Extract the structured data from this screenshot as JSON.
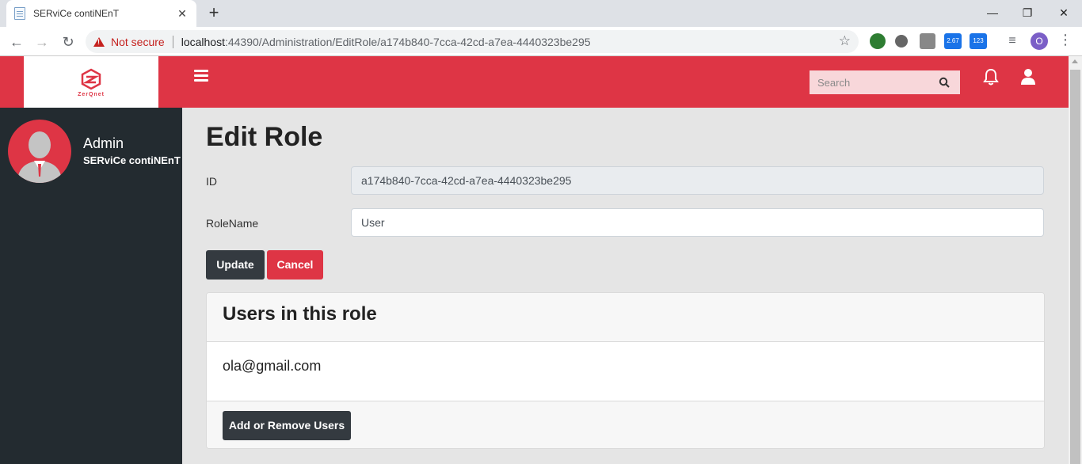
{
  "browser": {
    "tab_title": "SERviCe contiNEnT",
    "tab_close": "✕",
    "new_tab": "+",
    "win_minimize": "—",
    "win_restore": "❐",
    "win_close": "✕",
    "back": "←",
    "forward": "→",
    "reload": "↻",
    "security_text": "Not secure",
    "url_host": "localhost",
    "url_rest": ":44390/Administration/EditRole/a174b840-7cca-42cd-a7ea-4440323be295",
    "star": "☆",
    "ext_badge_1": "2.67",
    "ext_badge_2": "123",
    "profile_initial": "O",
    "menu": "⋮"
  },
  "app": {
    "brand_text": "ZerQnet",
    "search_placeholder": "Search",
    "colors": {
      "primary": "#de3545",
      "dark": "#343a40",
      "sidebar": "#232b30"
    }
  },
  "sidebar": {
    "user_name": "Admin",
    "user_org": "SERviCe contiNEnT"
  },
  "main": {
    "title": "Edit Role",
    "id_label": "ID",
    "id_value": "a174b840-7cca-42cd-a7ea-4440323be295",
    "rolename_label": "RoleName",
    "rolename_value": "User",
    "update_label": "Update",
    "cancel_label": "Cancel",
    "users_card": {
      "title": "Users in this role",
      "users": [
        "ola@gmail.com"
      ],
      "action_label": "Add or Remove Users"
    }
  }
}
